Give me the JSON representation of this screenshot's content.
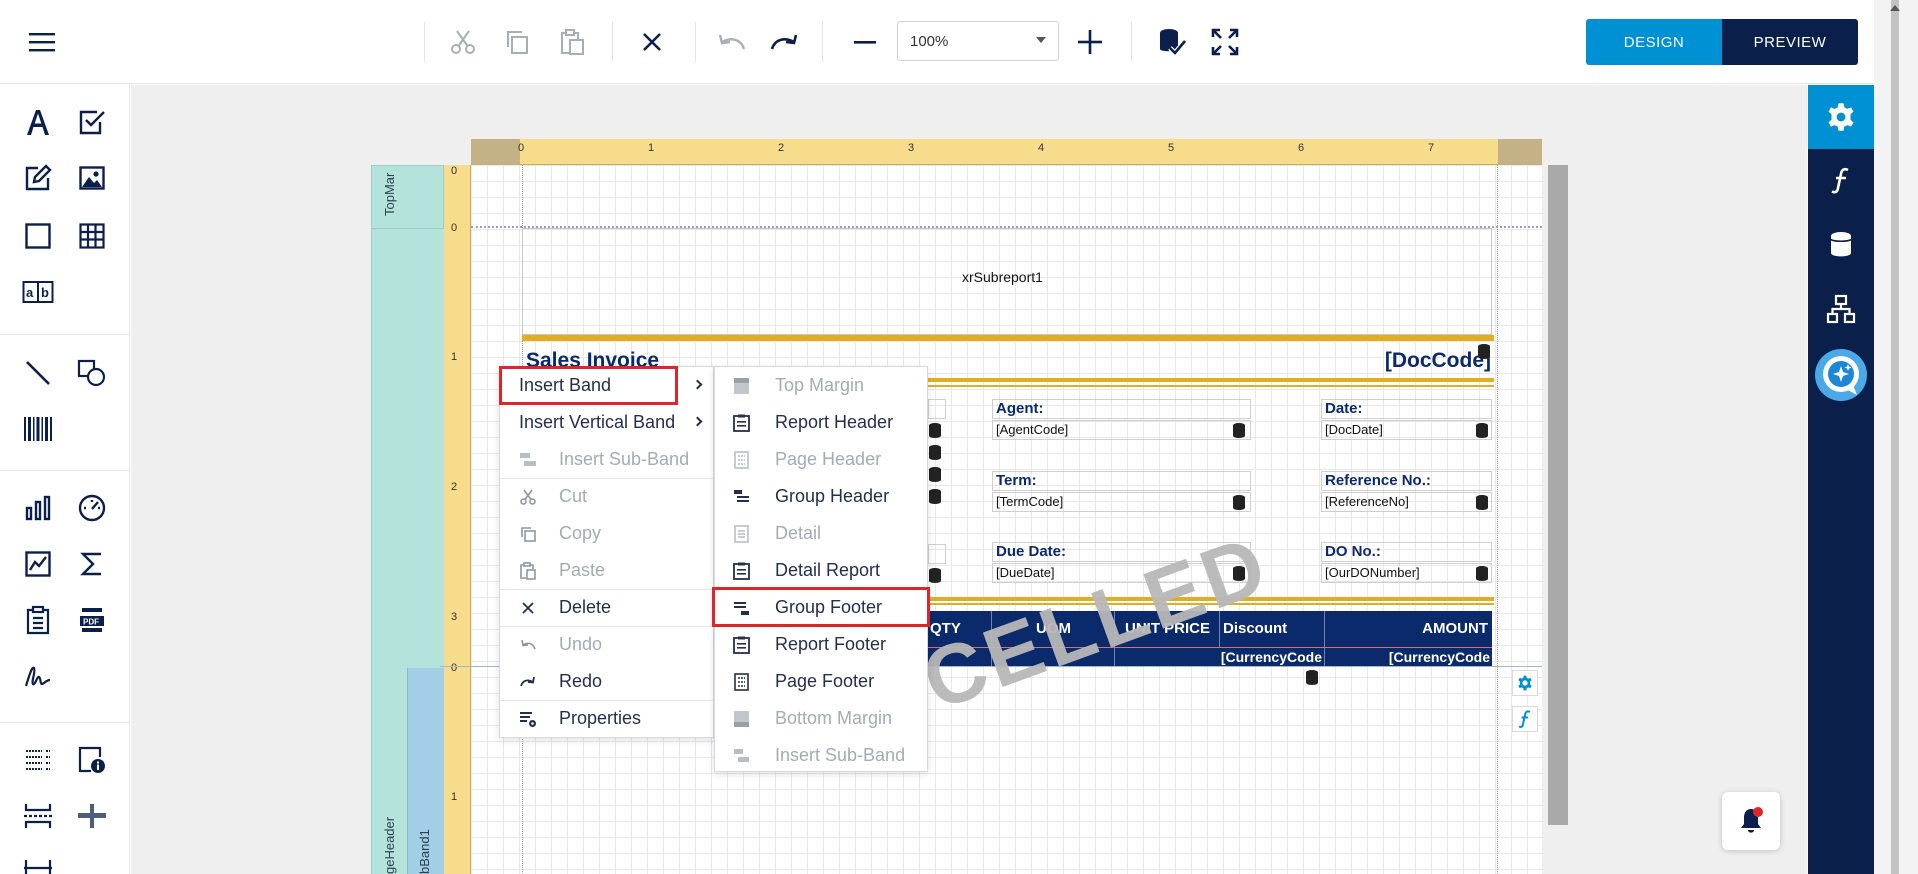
{
  "toolbar": {
    "zoom_value": "100%",
    "design_label": "DESIGN",
    "preview_label": "PREVIEW"
  },
  "ruler": {
    "top_numbers": [
      "0",
      "1",
      "2",
      "3",
      "4",
      "5",
      "6",
      "7"
    ],
    "left_numbers_band1": [
      "0"
    ],
    "left_numbers_band2": [
      "0",
      "1",
      "2",
      "3"
    ],
    "left_numbers_band3": [
      "0",
      "1"
    ]
  },
  "bands": {
    "top_margin": "TopMar",
    "page_header": "geHeader",
    "sub_band": "bBand1"
  },
  "report": {
    "subreport_label": "xrSubreport1",
    "title": "Sales Invoice",
    "doc_code": "[DocCode]",
    "agent_label": "Agent:",
    "agent_value": "[AgentCode]",
    "date_label": "Date:",
    "date_value": "[DocDate]",
    "term_label": "Term:",
    "term_value": "[TermCode]",
    "refno_label": "Reference No.:",
    "refno_value": "[ReferenceNo]",
    "duedate_label": "Due Date:",
    "duedate_value": "[DueDate]",
    "dono_label": "DO No.:",
    "dono_value": "[OurDONumber]",
    "table_headers": [
      "QTY",
      "UOM",
      "UNIT PRICE",
      "Discount",
      "AMOUNT"
    ],
    "currency_1": "[CurrencyCode",
    "currency_2": "[CurrencyCode",
    "watermark": "CANCELLED"
  },
  "context_menu": {
    "insert_band": "Insert Band",
    "insert_vertical_band": "Insert Vertical Band",
    "insert_sub_band": "Insert Sub-Band",
    "cut": "Cut",
    "copy": "Copy",
    "paste": "Paste",
    "delete": "Delete",
    "undo": "Undo",
    "redo": "Redo",
    "properties": "Properties"
  },
  "submenu": {
    "top_margin": "Top Margin",
    "report_header": "Report Header",
    "page_header": "Page Header",
    "group_header": "Group Header",
    "detail": "Detail",
    "detail_report": "Detail Report",
    "group_footer": "Group Footer",
    "report_footer": "Report Footer",
    "page_footer": "Page Footer",
    "bottom_margin": "Bottom Margin",
    "insert_sub_band": "Insert Sub-Band"
  },
  "colors": {
    "navy": "#0b1f4b",
    "accent_blue": "#0090d4",
    "highlight_red": "#e0242a",
    "gold": "#e3ad22"
  }
}
